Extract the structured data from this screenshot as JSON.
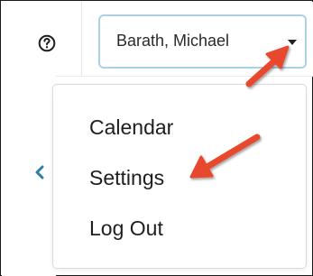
{
  "header": {
    "help_icon": "question-circle-icon",
    "user_menu": {
      "label": "Barath, Michael",
      "caret_icon": "caret-down-icon",
      "border_color": "#a9d2e4"
    }
  },
  "sidebar": {
    "collapse_icon": "chevron-left-icon",
    "icon_color": "#2f7fa6"
  },
  "dropdown": {
    "items": [
      {
        "label": "Calendar"
      },
      {
        "label": "Settings"
      },
      {
        "label": "Log Out"
      }
    ]
  },
  "annotations": {
    "arrow_color": "#e8492f",
    "arrows": [
      "arrow-to-user-menu",
      "arrow-to-settings"
    ]
  }
}
